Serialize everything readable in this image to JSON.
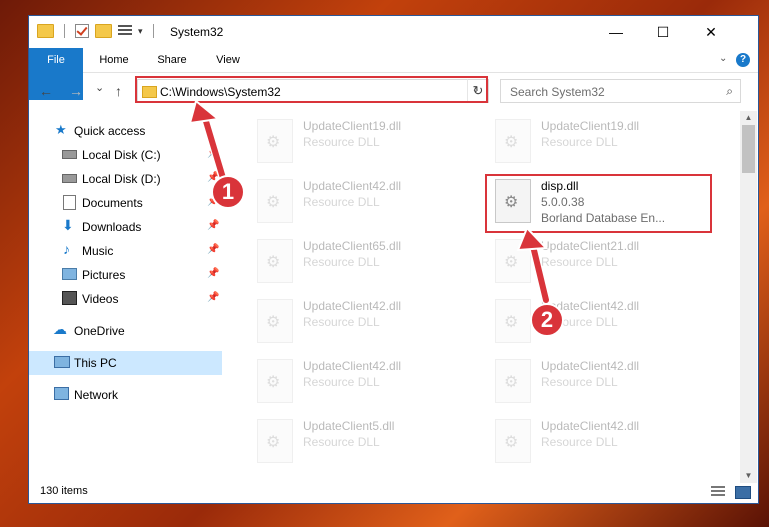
{
  "window": {
    "title": "System32",
    "minimize_glyph": "—",
    "maximize_glyph": "☐",
    "close_glyph": "✕"
  },
  "ribbon": {
    "tabs": [
      "File",
      "Home",
      "Share",
      "View"
    ],
    "help_glyph": "?"
  },
  "navigation": {
    "back_glyph": "←",
    "forward_glyph": "→",
    "recent_glyph": "⌄",
    "up_glyph": "↑",
    "address": "C:\\Windows\\System32",
    "refresh_glyph": "↻",
    "search_placeholder": "Search System32",
    "search_glyph": "⌕"
  },
  "sidebar": {
    "items": [
      {
        "label": "Quick access",
        "icon": "star-icon",
        "pinned": false
      },
      {
        "label": "Local Disk (C:)",
        "icon": "drive-icon",
        "pinned": true
      },
      {
        "label": "Local Disk (D:)",
        "icon": "drive-icon",
        "pinned": true
      },
      {
        "label": "Documents",
        "icon": "documents-icon",
        "pinned": true
      },
      {
        "label": "Downloads",
        "icon": "download-icon",
        "pinned": true
      },
      {
        "label": "Music",
        "icon": "music-icon",
        "pinned": true
      },
      {
        "label": "Pictures",
        "icon": "pictures-icon",
        "pinned": true
      },
      {
        "label": "Videos",
        "icon": "videos-icon",
        "pinned": true
      },
      {
        "label": "OneDrive",
        "icon": "cloud-icon",
        "pinned": false
      },
      {
        "label": "This PC",
        "icon": "computer-icon",
        "pinned": false,
        "selected": true
      },
      {
        "label": "Network",
        "icon": "network-icon",
        "pinned": false
      }
    ],
    "pin_glyph": "📌"
  },
  "files": {
    "left_column": [
      {
        "name": "UpdateClient19.dll",
        "type": "Resource DLL"
      },
      {
        "name": "UpdateClient42.dll",
        "type": "Resource DLL"
      },
      {
        "name": "UpdateClient65.dll",
        "type": "Resource DLL"
      },
      {
        "name": "UpdateClient42.dll",
        "type": "Resource DLL"
      },
      {
        "name": "UpdateClient42.dll",
        "type": "Resource DLL"
      },
      {
        "name": "UpdateClient5.dll",
        "type": "Resource DLL"
      }
    ],
    "right_column": [
      {
        "name": "UpdateClient19.dll",
        "type": "Resource DLL"
      },
      {
        "name": "disp.dll",
        "version": "5.0.0.38",
        "description": "Borland Database En...",
        "highlighted": true
      },
      {
        "name": "UpdateClient21.dll",
        "type": "Resource DLL"
      },
      {
        "name": "UpdateClient42.dll",
        "type": "Resource DLL"
      },
      {
        "name": "UpdateClient42.dll",
        "type": "Resource DLL"
      },
      {
        "name": "UpdateClient42.dll",
        "type": "Resource DLL"
      }
    ]
  },
  "status": {
    "item_count": "130 items"
  },
  "annotations": {
    "marker_1": "1",
    "marker_2": "2",
    "highlight_color": "#d9343a"
  },
  "colors": {
    "accent": "#1979ca",
    "selection": "#cce8ff"
  }
}
